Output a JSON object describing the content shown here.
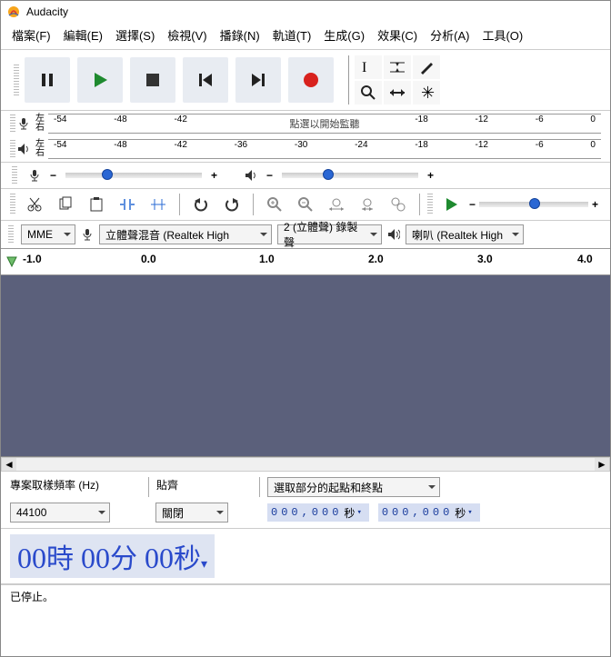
{
  "title": "Audacity",
  "menu": [
    "檔案(F)",
    "編輯(E)",
    "選擇(S)",
    "檢視(V)",
    "播錄(N)",
    "軌道(T)",
    "生成(G)",
    "效果(C)",
    "分析(A)",
    "工具(O)"
  ],
  "meter_ticks": [
    "-54",
    "-48",
    "-42",
    "-36",
    "-30",
    "-24",
    "-18",
    "-12",
    "-6",
    "0"
  ],
  "meter_hint": "點選以開始監聽",
  "lr_top": "左",
  "lr_bot": "右",
  "audio_host": "MME",
  "rec_device": "立體聲混音 (Realtek High",
  "rec_channels": "2 (立體聲) 錄製聲",
  "play_device": "喇叭 (Realtek High",
  "timeline_labels": [
    "-1.0",
    "0.0",
    "1.0",
    "2.0",
    "3.0",
    "4.0"
  ],
  "bottom": {
    "rate_label": "專案取樣頻率 (Hz)",
    "rate_value": "44100",
    "snap_label": "貼齊",
    "snap_value": "關閉",
    "sel_label": "選取部分的起點和終點",
    "t1": "000,000",
    "t1_suffix": "秒",
    "t2": "000,000",
    "t2_suffix": "秒"
  },
  "bigtime": {
    "h": "00",
    "hu": "時",
    "m": "00",
    "mu": "分",
    "s": "00",
    "su": "秒"
  },
  "status": "已停止。"
}
